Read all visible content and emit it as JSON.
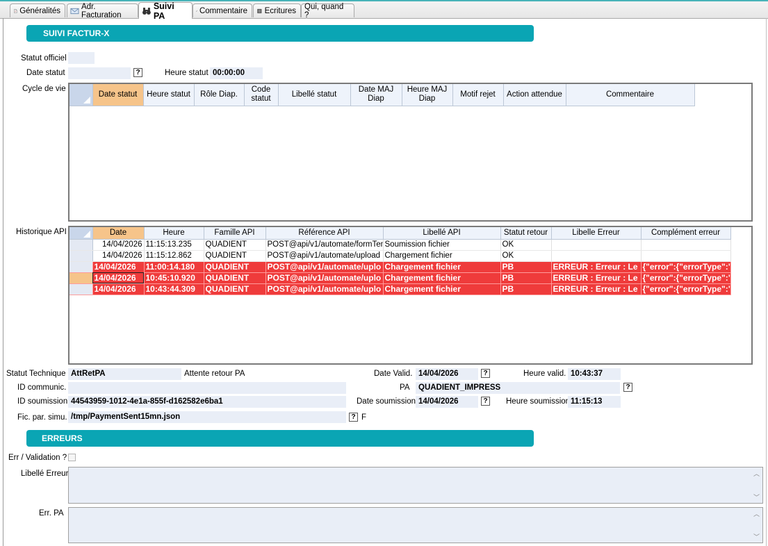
{
  "tabs": [
    {
      "label": "Généralités",
      "icon": "document-icon"
    },
    {
      "label": "Adr. Facturation",
      "icon": "envelope-icon"
    },
    {
      "label": "Suivi PA",
      "icon": "binoculars-icon"
    },
    {
      "label": "Commentaire",
      "icon": "pencil-icon"
    },
    {
      "label": "Ecritures",
      "icon": "ledger-icon"
    },
    {
      "label": "Qui, quand ?",
      "icon": ""
    }
  ],
  "colors": {
    "accent": "#0aa5b4",
    "error_row": "#ef3b3b",
    "selected_header": "#f6c48a",
    "field_bg": "#e9eef7"
  },
  "suivi": {
    "section_title": "SUIVI FACTUR-X",
    "statut_officiel_label": "Statut officiel",
    "statut_officiel_value": "",
    "date_statut_label": "Date statut",
    "date_statut_value": "",
    "heure_statut_label": "Heure statut",
    "heure_statut_value": "00:00:00",
    "cycle_label": "Cycle de vie",
    "cycle_columns": [
      "Date statut",
      "Heure statut",
      "Rôle Diap.",
      "Code statut",
      "Libellé statut",
      "Date MAJ Diap",
      "Heure MAJ Diap",
      "Motif rejet",
      "Action attendue",
      "Commentaire"
    ],
    "historique_label": "Historique API",
    "historique_columns": [
      "Date",
      "Heure",
      "Famille API",
      "Référence API",
      "Libellé API",
      "Statut retour",
      "Libelle Erreur",
      "Complément erreur"
    ],
    "historique_rows": [
      {
        "date": "14/04/2026",
        "heure": "11:15:13.235",
        "famille": "QUADIENT",
        "reference": "POST@api/v1/automate/formTem",
        "libelle": "Soumission fichier",
        "statut": "OK",
        "erreur": "",
        "complement": "",
        "error": false
      },
      {
        "date": "14/04/2026",
        "heure": "11:15:12.862",
        "famille": "QUADIENT",
        "reference": "POST@api/v1/automate/upload",
        "libelle": "Chargement fichier",
        "statut": "OK",
        "erreur": "",
        "complement": "",
        "error": false
      },
      {
        "date": "14/04/2026",
        "heure": "11:00:14.180",
        "famille": "QUADIENT",
        "reference": "POST@api/v1/automate/uplo",
        "libelle": "Chargement fichier",
        "statut": "PB",
        "erreur": "ERREUR : Erreur : Le",
        "complement": "{\"error\":{\"errorType\":\"",
        "error": true
      },
      {
        "date": "14/04/2026",
        "heure": "10:45:10.920",
        "famille": "QUADIENT",
        "reference": "POST@api/v1/automate/uplo",
        "libelle": "Chargement fichier",
        "statut": "PB",
        "erreur": "ERREUR : Erreur : Le",
        "complement": "{\"error\":{\"errorType\":\"",
        "error": true
      },
      {
        "date": "14/04/2026",
        "heure": "10:43:44.309",
        "famille": "QUADIENT",
        "reference": "POST@api/v1/automate/uplo",
        "libelle": "Chargement fichier",
        "statut": "PB",
        "erreur": "ERREUR : Erreur : Le",
        "complement": "{\"error\":{\"errorType\":\"",
        "error": true
      }
    ],
    "statut_technique_label": "Statut Technique",
    "statut_technique_value": "AttRetPA",
    "statut_technique_desc": "Attente retour PA",
    "date_valid_label": "Date Valid.",
    "date_valid_value": "14/04/2026",
    "heure_valid_label": "Heure valid.",
    "heure_valid_value": "10:43:37",
    "id_communic_label": "ID communic.",
    "id_communic_value": "",
    "pa_label": "PA",
    "pa_value": "QUADIENT_IMPRESS",
    "id_soumission_label": "ID soumission",
    "id_soumission_value": "44543959-1012-4e1a-855f-d162582e6ba1",
    "date_soumission_label": "Date soumission",
    "date_soumission_value": "14/04/2026",
    "heure_soumission_label": "Heure soumission",
    "heure_soumission_value": "11:15:13",
    "fic_simu_label": "Fic. par. simu.",
    "fic_simu_value": "/tmp/PaymentSent15mn.json",
    "fic_simu_flag": "F",
    "help_glyph": "?"
  },
  "erreurs": {
    "section_title": "ERREURS",
    "err_validation_label": "Err / Validation ?",
    "err_validation_checked": false,
    "libelle_erreur_label": "Libellé Erreur",
    "libelle_erreur_value": "",
    "err_pa_label": "Err. PA",
    "err_pa_value": ""
  }
}
